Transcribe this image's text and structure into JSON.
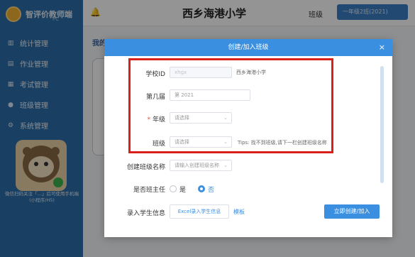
{
  "sidebar": {
    "brand": "智评价教师端",
    "brand_sub": "PC",
    "items": [
      {
        "label": "统计管理",
        "icon": "chart-icon"
      },
      {
        "label": "作业管理",
        "icon": "homework-icon"
      },
      {
        "label": "考试管理",
        "icon": "exam-icon"
      },
      {
        "label": "班级管理",
        "icon": "class-icon"
      },
      {
        "label": "系统管理",
        "icon": "settings-icon"
      }
    ],
    "note": "微信扫码关注「…」后可使用手机端(小程序/H5)"
  },
  "topbar": {
    "school": "西乡海港小学",
    "class_label": "班级",
    "class_value": "一年级2班(2021)"
  },
  "page": {
    "title": "我的班级"
  },
  "modal": {
    "title": "创建/加入班级",
    "close": "×",
    "school_id_label": "学校ID",
    "school_id_value": "xhgx",
    "school_name": "西乡海港小学",
    "term_label": "第几届",
    "term_value": "第 2021",
    "grade_label": "年级",
    "grade_placeholder": "请选择",
    "class_label": "班级",
    "class_placeholder": "请选择",
    "class_tip": "Tips: 找不到班级,请下一栏创建班级名称",
    "class_name_label": "创建班级名称",
    "class_name_placeholder": "请输入创建班级名称",
    "head_teacher_label": "是否班主任",
    "yes": "是",
    "no": "否",
    "head_teacher_selected": "否",
    "student_label": "录入学生信息",
    "student_btn": "Excel录入学生信息",
    "template": "模板",
    "submit": "立即创建/加入"
  },
  "colors": {
    "sidebar": "#2c6fa9",
    "accent": "#3b8fe0",
    "highlight_box": "#d9201b"
  }
}
